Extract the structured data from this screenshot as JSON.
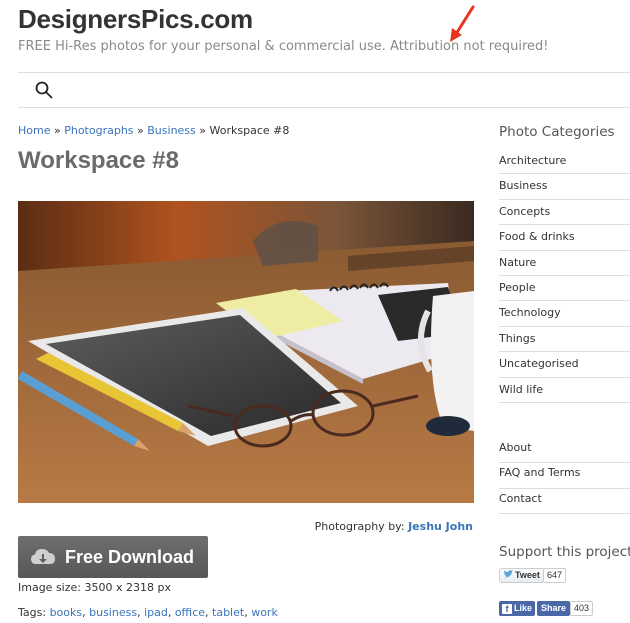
{
  "header": {
    "site_title": "DesignersPics.com",
    "tagline": "FREE Hi-Res photos for your personal & commercial use. Attribution not required!"
  },
  "search": {
    "icon": "search-icon"
  },
  "breadcrumb": {
    "home": "Home",
    "photographs": "Photographs",
    "business": "Business",
    "current": "Workspace #8",
    "separator": "»"
  },
  "post": {
    "title": "Workspace #8",
    "credit_label": "Photography by:",
    "credit_name": "Jeshu John",
    "download_label": "Free Download",
    "image_size": "Image size: 3500 x 2318 px",
    "tags_label": "Tags:",
    "tags": [
      "books",
      "business",
      "ipad",
      "office",
      "tablet",
      "work"
    ]
  },
  "sidebar": {
    "categories_heading": "Photo Categories",
    "categories": [
      "Architecture",
      "Business",
      "Concepts",
      "Food & drinks",
      "Nature",
      "People",
      "Technology",
      "Things",
      "Uncategorised",
      "Wild life"
    ],
    "pages": [
      "About",
      "FAQ and Terms",
      "Contact"
    ],
    "support_heading": "Support this project",
    "tweet_label": "Tweet",
    "tweet_count": "647",
    "fb_like_label": "Like",
    "fb_share_label": "Share",
    "share_count": "403"
  },
  "colors": {
    "link": "#3a74b9",
    "download_button": "#5f5f5f",
    "facebook": "#4a67a8",
    "annotation_arrow": "#e8341c"
  }
}
